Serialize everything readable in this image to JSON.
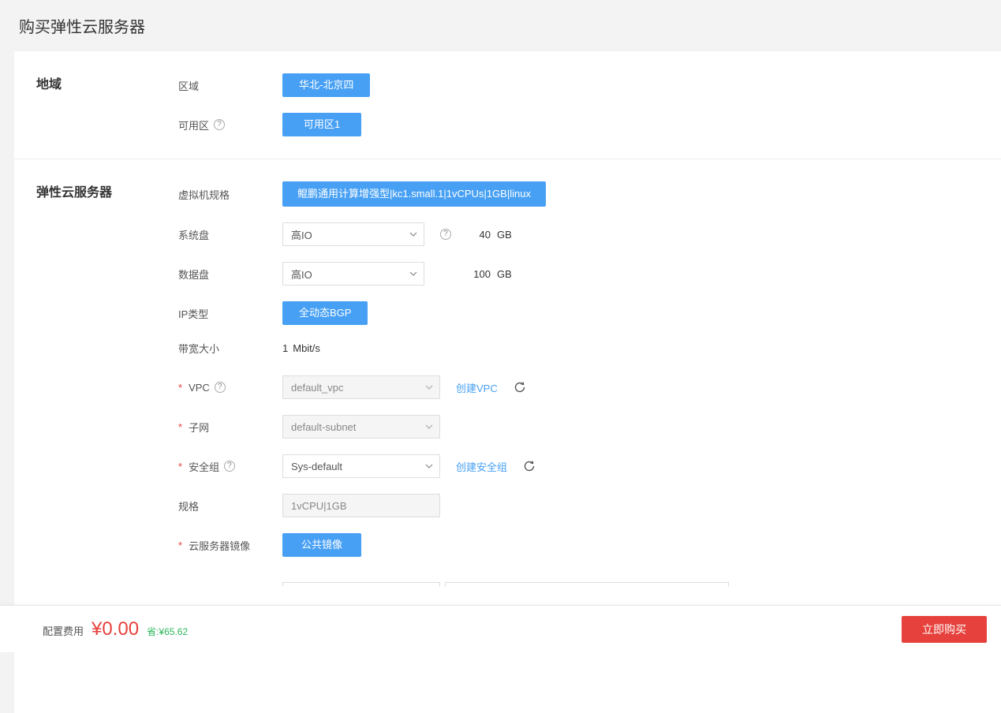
{
  "page_title": "购买弹性云服务器",
  "section_region": {
    "title": "地域",
    "region_label": "区域",
    "region_value": "华北-北京四",
    "az_label": "可用区",
    "az_value": "可用区1"
  },
  "section_ecs": {
    "title": "弹性云服务器",
    "spec_label": "虚拟机规格",
    "spec_value": "鲲鹏通用计算增强型|kc1.small.1|1vCPUs|1GB|linux",
    "sysdisk_label": "系统盘",
    "sysdisk_type": "高IO",
    "sysdisk_size": "40",
    "sysdisk_unit": "GB",
    "datadisk_label": "数据盘",
    "datadisk_type": "高IO",
    "datadisk_size": "100",
    "datadisk_unit": "GB",
    "iptype_label": "IP类型",
    "iptype_value": "全动态BGP",
    "bw_label": "带宽大小",
    "bw_value": "1",
    "bw_unit": "Mbit/s",
    "vpc_label": "VPC",
    "vpc_value": "default_vpc",
    "vpc_create": "创建VPC",
    "subnet_label": "子网",
    "subnet_value": "default-subnet",
    "sg_label": "安全组",
    "sg_value": "Sys-default",
    "sg_create": "创建安全组",
    "flavor_label": "规格",
    "flavor_value": "1vCPU|1GB",
    "image_label": "云服务器镜像",
    "image_value": "公共镜像"
  },
  "footer": {
    "fee_label": "配置费用",
    "fee_amount": "¥0.00",
    "fee_save": "省:¥65.62",
    "buy_label": "立即购买"
  }
}
